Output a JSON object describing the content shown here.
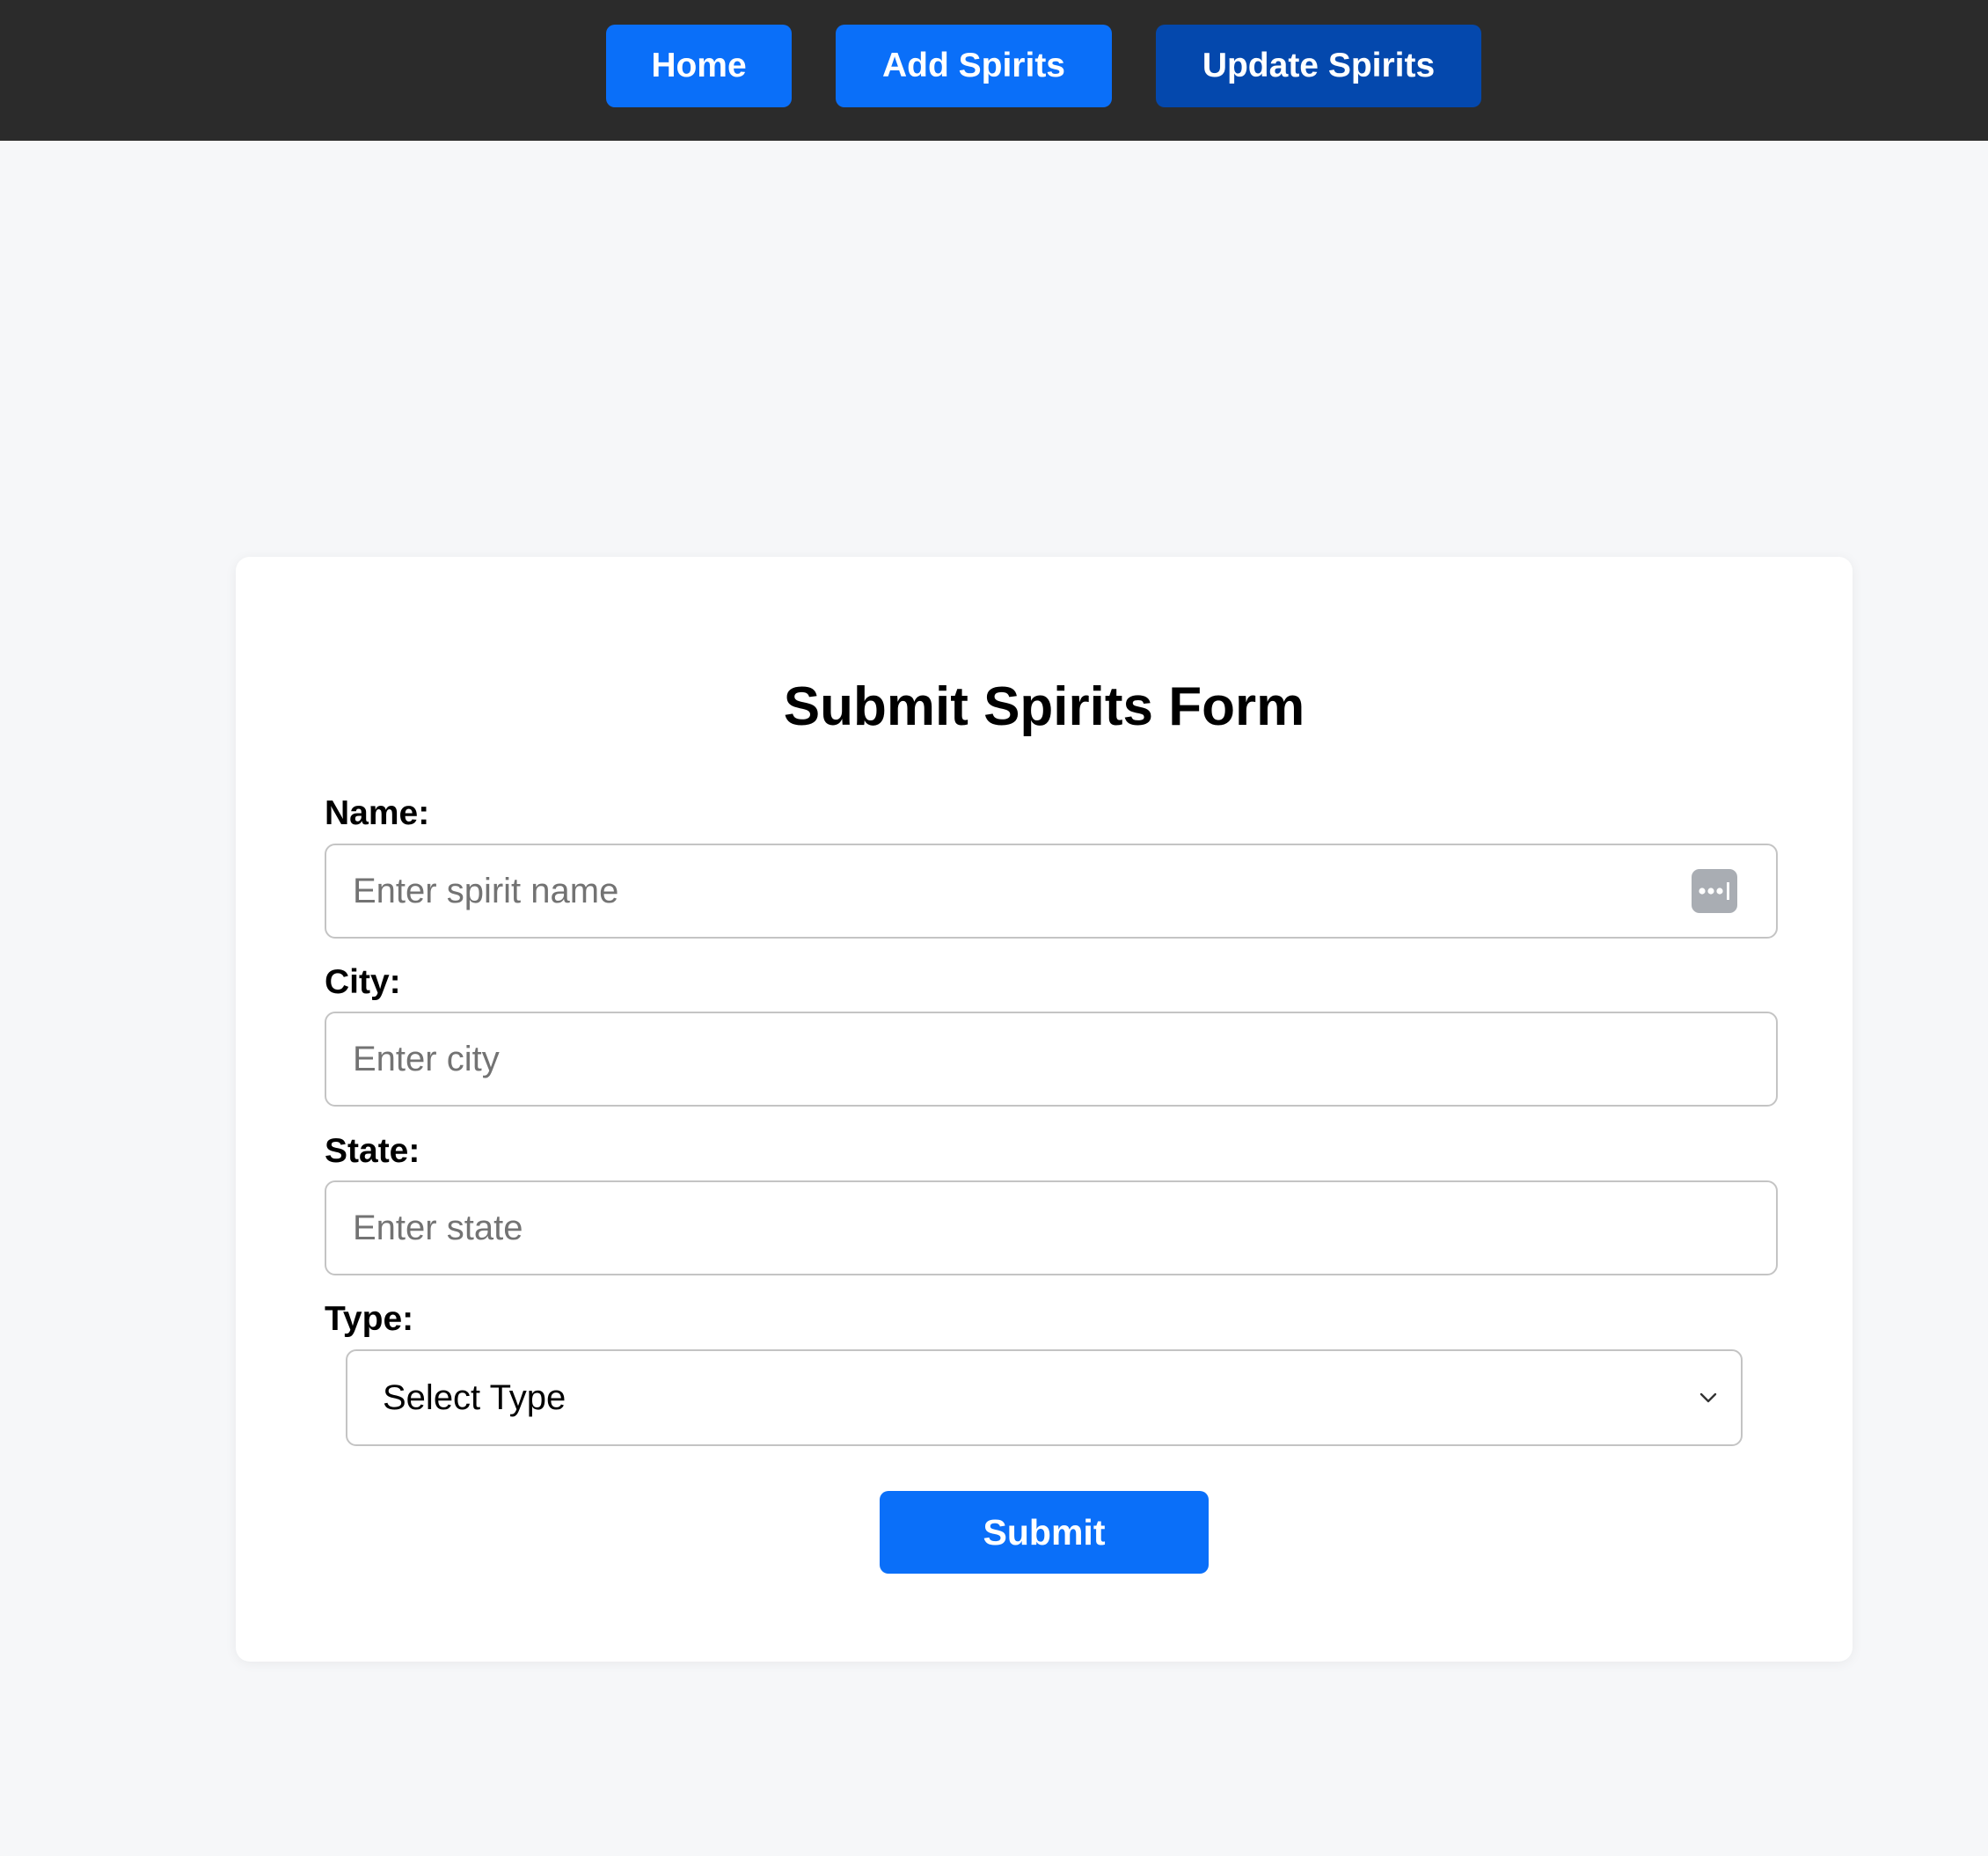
{
  "nav": {
    "home_label": "Home",
    "add_label": "Add Spirits",
    "update_label": "Update Spirits"
  },
  "form": {
    "title": "Submit Spirits Form",
    "name": {
      "label": "Name:",
      "placeholder": "Enter spirit name",
      "value": ""
    },
    "city": {
      "label": "City:",
      "placeholder": "Enter city",
      "value": ""
    },
    "state": {
      "label": "State:",
      "placeholder": "Enter state",
      "value": ""
    },
    "type": {
      "label": "Type:",
      "selected": "Select Type"
    },
    "submit_label": "Submit"
  },
  "icons": {
    "name_field_icon": "password-manager-icon",
    "select_arrow": "chevron-down-icon"
  },
  "colors": {
    "nav_bg": "#2b2b2b",
    "primary_button": "#0a6ff9",
    "active_button": "#0448ad",
    "page_bg": "#f6f7f9",
    "card_bg": "#ffffff"
  }
}
